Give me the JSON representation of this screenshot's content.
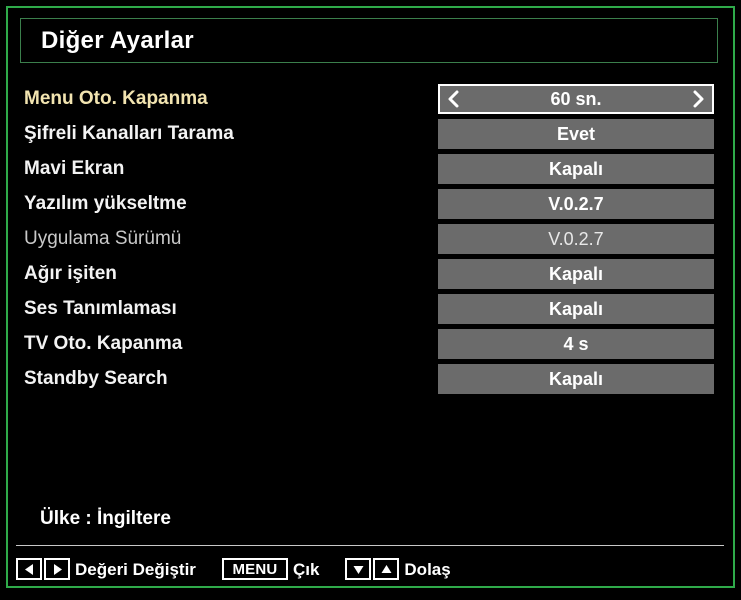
{
  "screen": {
    "title": "Diğer Ayarlar",
    "frame_color": "#2faa4a",
    "background_color": "#000000",
    "selected_label_color": "#f2e4b0",
    "value_box_color": "#6b6b6b"
  },
  "settings": [
    {
      "label": "Menu Oto. Kapanma",
      "value": "60 sn.",
      "selected": true,
      "disabled": false
    },
    {
      "label": "Şifreli Kanalları Tarama",
      "value": "Evet",
      "selected": false,
      "disabled": false
    },
    {
      "label": "Mavi Ekran",
      "value": "Kapalı",
      "selected": false,
      "disabled": false
    },
    {
      "label": "Yazılım yükseltme",
      "value": "V.0.2.7",
      "selected": false,
      "disabled": false
    },
    {
      "label": "Uygulama Sürümü",
      "value": "V.0.2.7",
      "selected": false,
      "disabled": true
    },
    {
      "label": "Ağır işiten",
      "value": "Kapalı",
      "selected": false,
      "disabled": false
    },
    {
      "label": "Ses Tanımlaması",
      "value": "Kapalı",
      "selected": false,
      "disabled": false
    },
    {
      "label": "TV Oto. Kapanma",
      "value": "4 s",
      "selected": false,
      "disabled": false
    },
    {
      "label": "Standby Search",
      "value": "Kapalı",
      "selected": false,
      "disabled": false
    }
  ],
  "footer": {
    "country_line": "Ülke : İngiltere",
    "hints": [
      {
        "keys": [
          "left-arrow-icon",
          "right-arrow-icon"
        ],
        "label": "Değeri Değiştir"
      },
      {
        "keys": [
          "MENU"
        ],
        "label": "Çık"
      },
      {
        "keys": [
          "down-arrow-icon",
          "up-arrow-icon"
        ],
        "label": "Dolaş"
      }
    ]
  }
}
